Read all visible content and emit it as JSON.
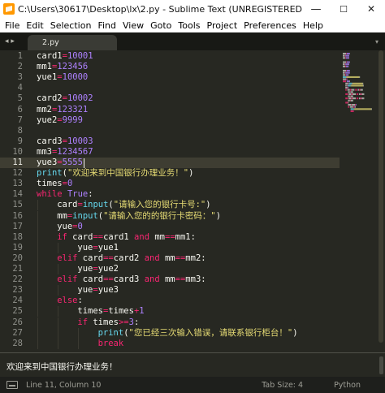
{
  "window": {
    "title": "C:\\Users\\30617\\Desktop\\lx\\2.py - Sublime Text (UNREGISTERED)",
    "controls": {
      "minimize": "—",
      "maximize": "☐",
      "close": "✕"
    }
  },
  "menu": {
    "items": [
      "File",
      "Edit",
      "Selection",
      "Find",
      "View",
      "Goto",
      "Tools",
      "Project",
      "Preferences",
      "Help"
    ]
  },
  "tabs": {
    "nav": "◂ ▸",
    "items": [
      {
        "label": "2.py",
        "active": true
      }
    ],
    "dropdown": "▾"
  },
  "editor": {
    "active_line": 11,
    "lines": [
      {
        "n": "1",
        "indent": 0,
        "tokens": [
          [
            "ident",
            "card1"
          ],
          [
            "op",
            "="
          ],
          [
            "num",
            "10001"
          ]
        ]
      },
      {
        "n": "2",
        "indent": 0,
        "tokens": [
          [
            "ident",
            "mm1"
          ],
          [
            "op",
            "="
          ],
          [
            "num",
            "123456"
          ]
        ]
      },
      {
        "n": "3",
        "indent": 0,
        "tokens": [
          [
            "ident",
            "yue1"
          ],
          [
            "op",
            "="
          ],
          [
            "num",
            "10000"
          ]
        ]
      },
      {
        "n": "4",
        "indent": 0,
        "tokens": []
      },
      {
        "n": "5",
        "indent": 0,
        "tokens": [
          [
            "ident",
            "card2"
          ],
          [
            "op",
            "="
          ],
          [
            "num",
            "10002"
          ]
        ]
      },
      {
        "n": "6",
        "indent": 0,
        "tokens": [
          [
            "ident",
            "mm2"
          ],
          [
            "op",
            "="
          ],
          [
            "num",
            "123321"
          ]
        ]
      },
      {
        "n": "7",
        "indent": 0,
        "tokens": [
          [
            "ident",
            "yue2"
          ],
          [
            "op",
            "="
          ],
          [
            "num",
            "9999"
          ]
        ]
      },
      {
        "n": "8",
        "indent": 0,
        "tokens": []
      },
      {
        "n": "9",
        "indent": 0,
        "tokens": [
          [
            "ident",
            "card3"
          ],
          [
            "op",
            "="
          ],
          [
            "num",
            "10003"
          ]
        ]
      },
      {
        "n": "10",
        "indent": 0,
        "tokens": [
          [
            "ident",
            "mm3"
          ],
          [
            "op",
            "="
          ],
          [
            "num",
            "1234567"
          ]
        ]
      },
      {
        "n": "11",
        "indent": 0,
        "tokens": [
          [
            "ident",
            "yue3"
          ],
          [
            "op",
            "="
          ],
          [
            "num",
            "5555"
          ]
        ]
      },
      {
        "n": "12",
        "indent": 0,
        "tokens": [
          [
            "fn",
            "print"
          ],
          [
            "punc",
            "("
          ],
          [
            "str",
            "\"欢迎来到中国银行办理业务！\""
          ],
          [
            "punc",
            ")"
          ]
        ]
      },
      {
        "n": "13",
        "indent": 0,
        "tokens": [
          [
            "ident",
            "times"
          ],
          [
            "op",
            "="
          ],
          [
            "num",
            "0"
          ]
        ]
      },
      {
        "n": "14",
        "indent": 0,
        "tokens": [
          [
            "kw",
            "while "
          ],
          [
            "const",
            "True"
          ],
          [
            "punc",
            ":"
          ]
        ]
      },
      {
        "n": "15",
        "indent": 1,
        "tokens": [
          [
            "ident",
            "card"
          ],
          [
            "op",
            "="
          ],
          [
            "fn",
            "input"
          ],
          [
            "punc",
            "("
          ],
          [
            "str",
            "\"请输入您的银行卡号:\""
          ],
          [
            "punc",
            ")"
          ]
        ]
      },
      {
        "n": "16",
        "indent": 1,
        "tokens": [
          [
            "ident",
            "mm"
          ],
          [
            "op",
            "="
          ],
          [
            "fn",
            "input"
          ],
          [
            "punc",
            "("
          ],
          [
            "str",
            "\"请输入您的的银行卡密码：\""
          ],
          [
            "punc",
            ")"
          ]
        ]
      },
      {
        "n": "17",
        "indent": 1,
        "tokens": [
          [
            "ident",
            "yue"
          ],
          [
            "op",
            "="
          ],
          [
            "num",
            "0"
          ]
        ]
      },
      {
        "n": "18",
        "indent": 1,
        "tokens": [
          [
            "kw",
            "if "
          ],
          [
            "ident",
            "card"
          ],
          [
            "op",
            "=="
          ],
          [
            "ident",
            "card1 "
          ],
          [
            "kw",
            "and "
          ],
          [
            "ident",
            "mm"
          ],
          [
            "op",
            "=="
          ],
          [
            "ident",
            "mm1"
          ],
          [
            "punc",
            ":"
          ]
        ]
      },
      {
        "n": "19",
        "indent": 2,
        "tokens": [
          [
            "ident",
            "yue"
          ],
          [
            "op",
            "="
          ],
          [
            "ident",
            "yue1"
          ]
        ]
      },
      {
        "n": "20",
        "indent": 1,
        "tokens": [
          [
            "kw",
            "elif "
          ],
          [
            "ident",
            "card"
          ],
          [
            "op",
            "=="
          ],
          [
            "ident",
            "card2 "
          ],
          [
            "kw",
            "and "
          ],
          [
            "ident",
            "mm"
          ],
          [
            "op",
            "=="
          ],
          [
            "ident",
            "mm2"
          ],
          [
            "punc",
            ":"
          ]
        ]
      },
      {
        "n": "21",
        "indent": 2,
        "tokens": [
          [
            "ident",
            "yue"
          ],
          [
            "op",
            "="
          ],
          [
            "ident",
            "yue2"
          ]
        ]
      },
      {
        "n": "22",
        "indent": 1,
        "tokens": [
          [
            "kw",
            "elif "
          ],
          [
            "ident",
            "card"
          ],
          [
            "op",
            "=="
          ],
          [
            "ident",
            "card3 "
          ],
          [
            "kw",
            "and "
          ],
          [
            "ident",
            "mm"
          ],
          [
            "op",
            "=="
          ],
          [
            "ident",
            "mm3"
          ],
          [
            "punc",
            ":"
          ]
        ]
      },
      {
        "n": "23",
        "indent": 2,
        "tokens": [
          [
            "ident",
            "yue"
          ],
          [
            "op",
            "="
          ],
          [
            "ident",
            "yue3"
          ]
        ]
      },
      {
        "n": "24",
        "indent": 1,
        "tokens": [
          [
            "kw",
            "else"
          ],
          [
            "punc",
            ":"
          ]
        ]
      },
      {
        "n": "25",
        "indent": 2,
        "tokens": [
          [
            "ident",
            "times"
          ],
          [
            "op",
            "="
          ],
          [
            "ident",
            "times"
          ],
          [
            "op",
            "+"
          ],
          [
            "num",
            "1"
          ]
        ]
      },
      {
        "n": "26",
        "indent": 2,
        "tokens": [
          [
            "kw",
            "if "
          ],
          [
            "ident",
            "times"
          ],
          [
            "op",
            ">="
          ],
          [
            "num",
            "3"
          ],
          [
            "punc",
            ":"
          ]
        ]
      },
      {
        "n": "27",
        "indent": 3,
        "tokens": [
          [
            "fn",
            "print"
          ],
          [
            "punc",
            "("
          ],
          [
            "str",
            "\"您已经三次输入错误，请联系银行柜台！\""
          ],
          [
            "punc",
            ")"
          ]
        ]
      },
      {
        "n": "28",
        "indent": 3,
        "tokens": [
          [
            "kw",
            "break"
          ]
        ]
      }
    ]
  },
  "console": {
    "output": "欢迎来到中国银行办理业务！"
  },
  "status": {
    "position": "Line 11, Column 10",
    "tab_size": "Tab Size: 4",
    "syntax": "Python"
  }
}
